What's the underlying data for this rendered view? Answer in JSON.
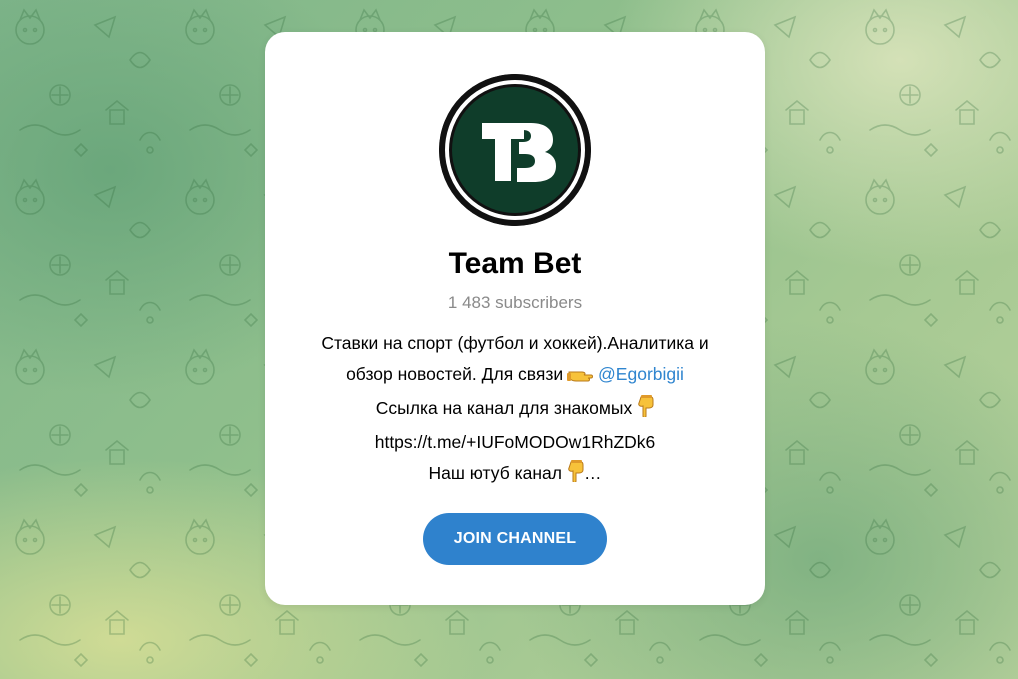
{
  "channel": {
    "name": "Team Bet",
    "subscribers": "1 483 subscribers",
    "avatar_letters": "TB",
    "avatar_color": "#0f3d2a"
  },
  "description": {
    "line1": "Ставки на спорт (футбол и хоккей).Аналитика и",
    "line2_text": "обзор новостей. Для связи",
    "line2_link": "@Egorbigii",
    "line3": "Ссылка на канал для знакомых",
    "line4": "https://t.me/+IUFoMODOw1RhZDk6",
    "line5": "Наш ютуб канал",
    "ellipsis": "…"
  },
  "join_button": {
    "label": "JOIN CHANNEL",
    "color": "#2f82cd"
  },
  "icons": {
    "point_right": "pointing-right-hand-icon",
    "point_down": "pointing-down-hand-icon"
  },
  "colors": {
    "link": "#2f85cf",
    "subtle_text": "#8a8a8a",
    "card_bg": "#ffffff"
  }
}
